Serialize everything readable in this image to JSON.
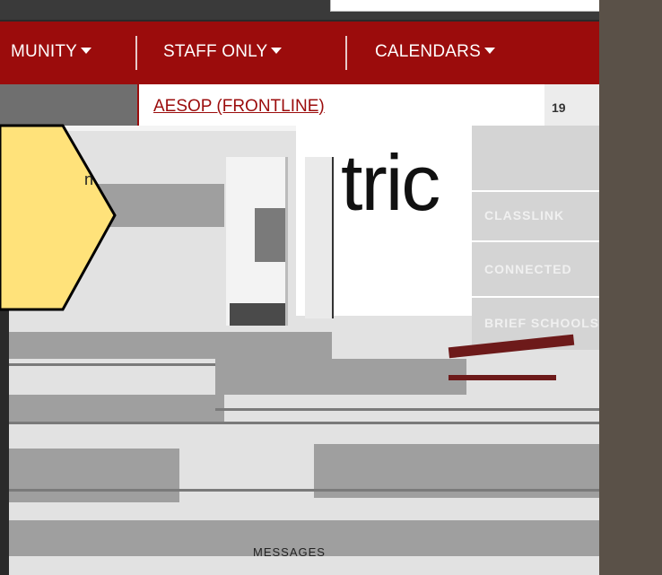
{
  "nav": {
    "items": [
      {
        "label": "MUNITY"
      },
      {
        "label": "STAFF ONLY"
      },
      {
        "label": "CALENDARS"
      }
    ]
  },
  "dropdown": {
    "items": [
      {
        "label": "AESOP (FRONTLINE)"
      }
    ]
  },
  "calendar_tab": {
    "number": "19"
  },
  "logo": {
    "text": "tric"
  },
  "callout": {
    "text": "n"
  },
  "sidebar": {
    "labels": [
      "CLASSLINK",
      "CONNECTED",
      "BRIEF SCHOOLS"
    ]
  },
  "footer": {
    "text": "MESSAGES"
  },
  "colors": {
    "nav_bg": "#9b0c0c",
    "callout_fill": "#ffe27a",
    "accent": "#6d1a1a"
  }
}
